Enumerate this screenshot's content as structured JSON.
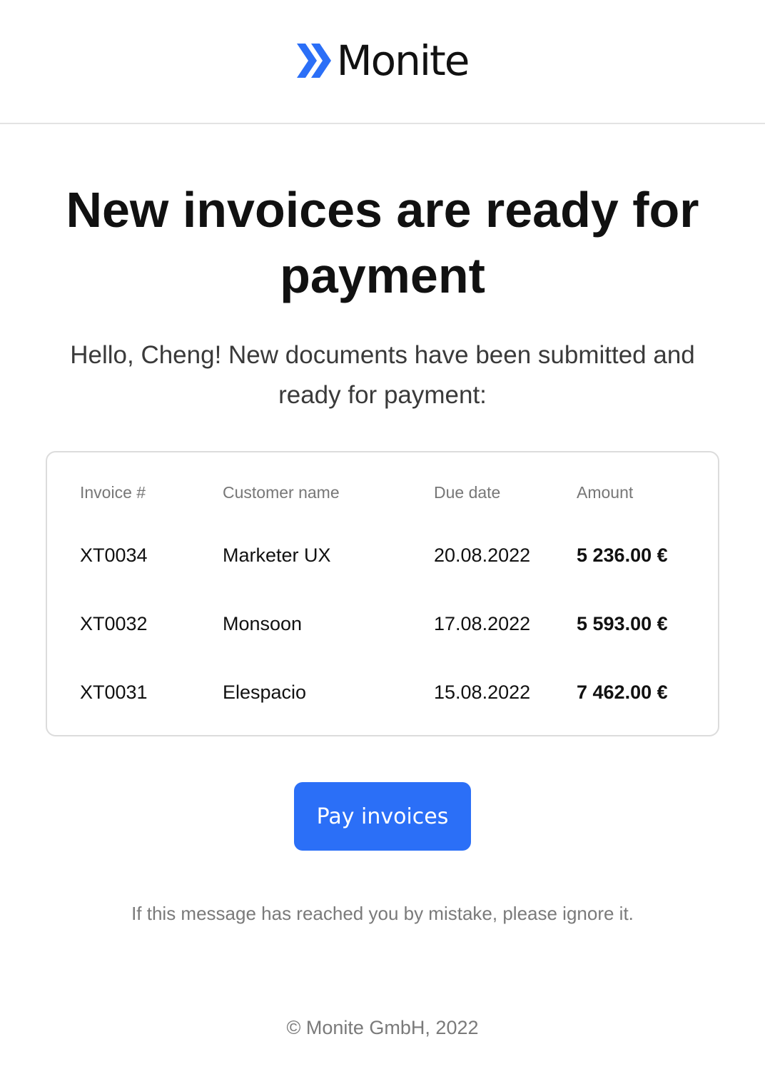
{
  "brand": {
    "name": "Monite",
    "accent_color": "#2b6ff7",
    "logo_icon": "double-chevron-right-icon"
  },
  "email": {
    "title": "New invoices are ready for payment",
    "intro": "Hello, Cheng! New documents have been submitted and ready for payment:"
  },
  "table": {
    "headers": [
      "Invoice #",
      "Customer name",
      "Due date",
      "Amount"
    ],
    "rows": [
      {
        "invoice": "XT0034",
        "customer": "Marketer UX",
        "due": "20.08.2022",
        "amount": "5 236.00 €"
      },
      {
        "invoice": "XT0032",
        "customer": "Monsoon",
        "due": "17.08.2022",
        "amount": "5 593.00 €"
      },
      {
        "invoice": "XT0031",
        "customer": "Elespacio",
        "due": "15.08.2022",
        "amount": "7 462.00 €"
      }
    ]
  },
  "actions": {
    "pay_label": "Pay invoices"
  },
  "notice": "If this message has reached you by mistake, please ignore it.",
  "footer": "© Monite GmbH, 2022"
}
